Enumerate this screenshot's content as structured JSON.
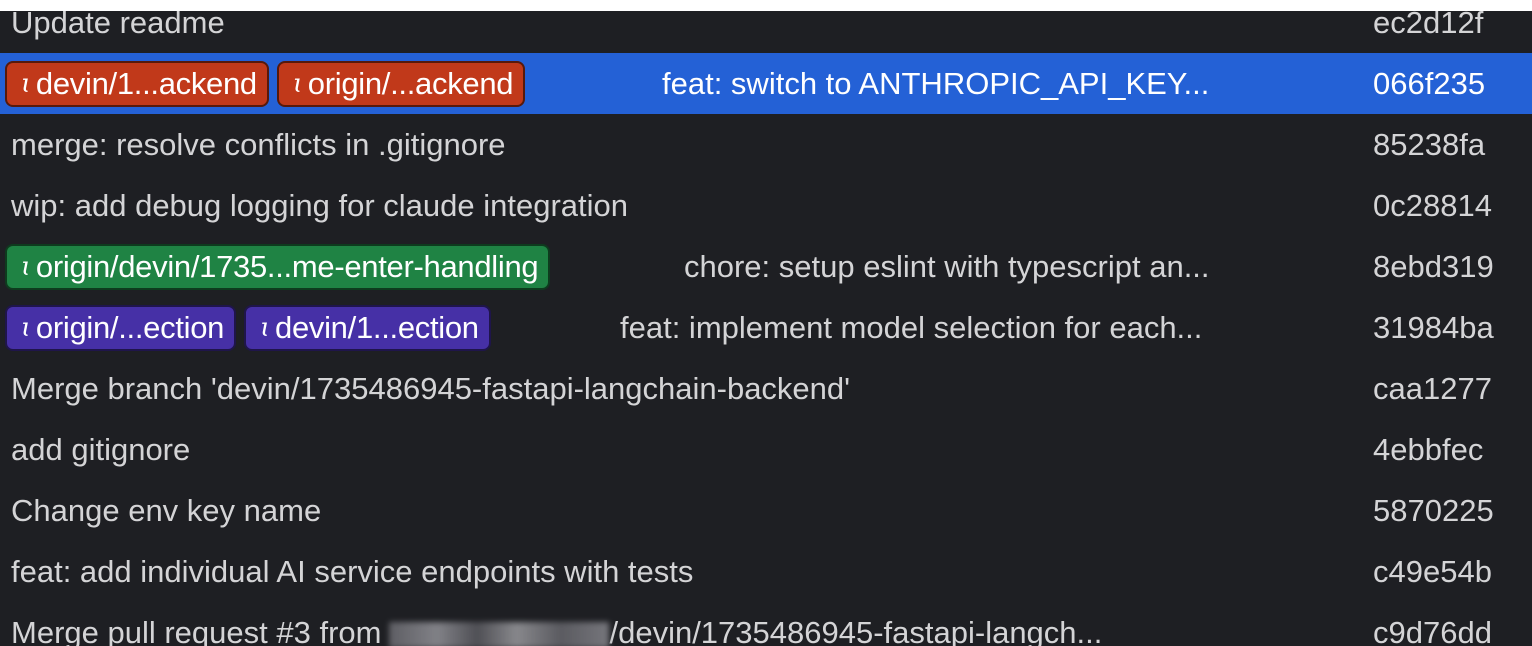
{
  "commits": [
    {
      "message": "Update readme",
      "hash": "ec2d12f"
    },
    {
      "refs": [
        {
          "label": "devin/1...ackend",
          "color": "#c1391a"
        },
        {
          "label": "origin/...ackend",
          "color": "#c1391a"
        }
      ],
      "message": "feat: switch to ANTHROPIC_API_KEY...",
      "hash": "066f235",
      "selected": true
    },
    {
      "message": "merge: resolve conflicts in .gitignore",
      "hash": "85238fa"
    },
    {
      "message": "wip: add debug logging for claude integration",
      "hash": "0c28814"
    },
    {
      "refs": [
        {
          "label": "origin/devin/1735...me-enter-handling",
          "color": "#1f8344"
        }
      ],
      "message": "chore: setup eslint with typescript an...",
      "hash": "8ebd319"
    },
    {
      "refs": [
        {
          "label": "origin/...ection",
          "color": "#4630a6"
        },
        {
          "label": "devin/1...ection",
          "color": "#4630a6"
        }
      ],
      "message": "feat: implement model selection for each...",
      "hash": "31984ba"
    },
    {
      "message": "Merge branch 'devin/1735486945-fastapi-langchain-backend'",
      "hash": "caa1277"
    },
    {
      "message": "add gitignore",
      "hash": "4ebbfec"
    },
    {
      "message": "Change env key name",
      "hash": "5870225"
    },
    {
      "message": "feat: add individual AI service endpoints with tests",
      "hash": "c49e54b"
    },
    {
      "message_prefix": "Merge pull request #3 from",
      "message_suffix": "/devin/1735486945-fastapi-langch...",
      "hash": "c9d76dd"
    }
  ],
  "colors": {
    "background": "#1e1f23",
    "selected_row": "#2461d6",
    "text": "#d4d4d6"
  },
  "icons": {
    "branch": "git-branch-icon"
  }
}
